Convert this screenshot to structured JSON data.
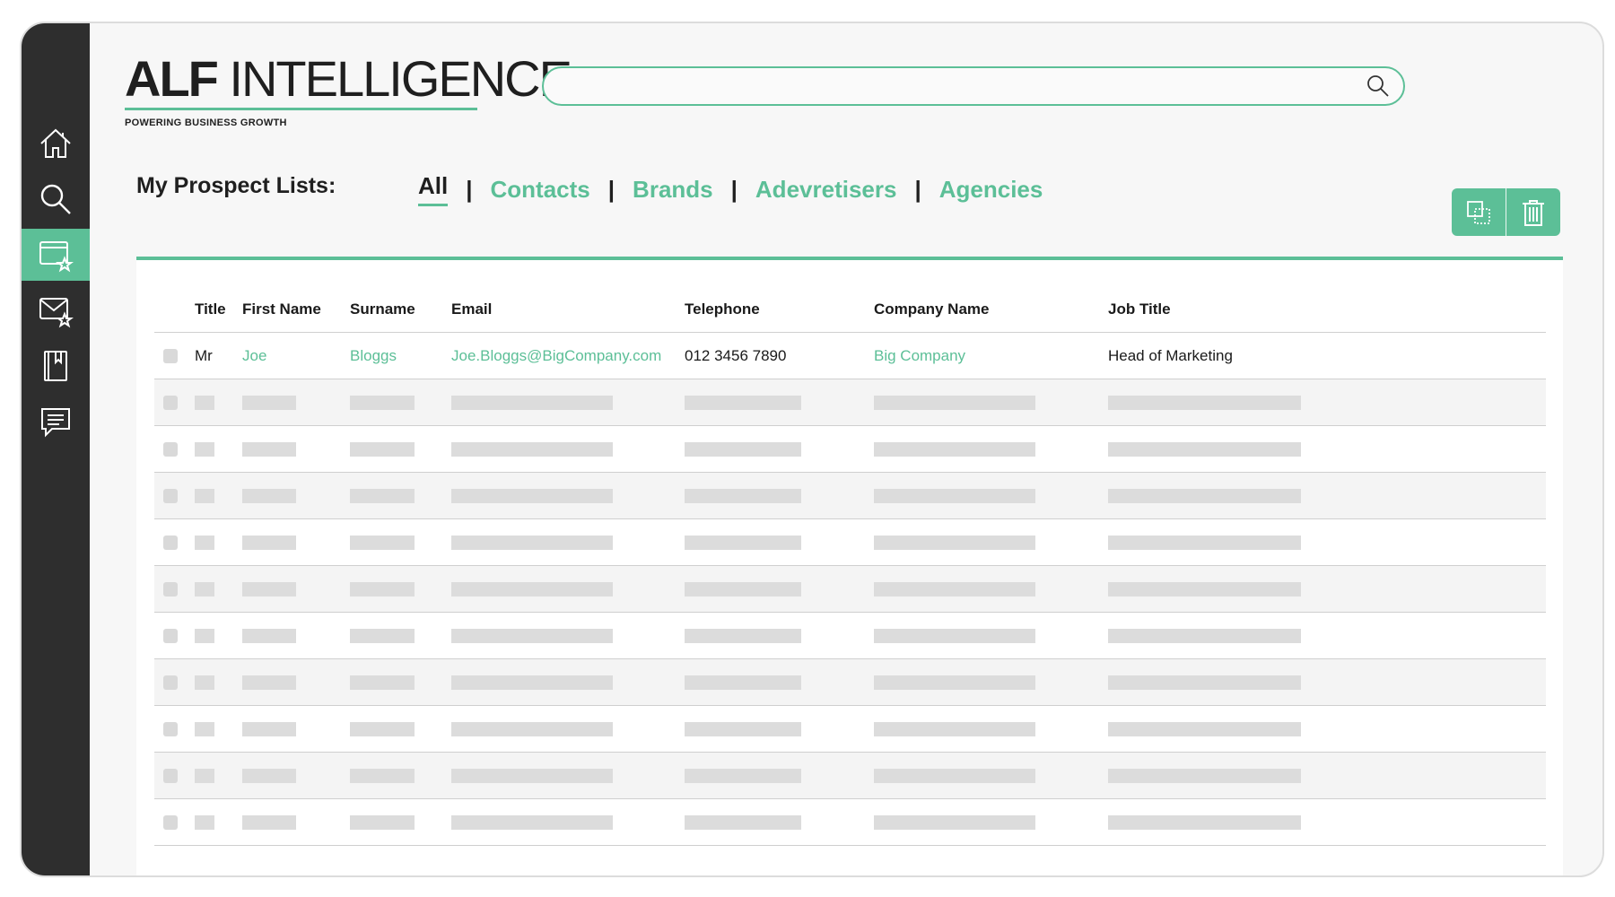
{
  "brand": {
    "logo_bold": "ALF",
    "logo_light": " INTELLIGENCE",
    "tagline": "POWERING BUSINESS GROWTH",
    "accent_color": "#5cbf97"
  },
  "sidebar": {
    "items": [
      {
        "icon": "home-icon",
        "active": false
      },
      {
        "icon": "search-icon",
        "active": false
      },
      {
        "icon": "browser-star-icon",
        "active": true
      },
      {
        "icon": "mail-star-icon",
        "active": false
      },
      {
        "icon": "bookmark-book-icon",
        "active": false
      },
      {
        "icon": "chat-icon",
        "active": false
      }
    ]
  },
  "search": {
    "placeholder": "",
    "value": ""
  },
  "prospect_lists": {
    "title": "My Prospect Lists:",
    "tabs": [
      {
        "label": "All",
        "active": true
      },
      {
        "label": "Contacts",
        "active": false
      },
      {
        "label": "Brands",
        "active": false
      },
      {
        "label": "Adevretisers",
        "active": false
      },
      {
        "label": "Agencies",
        "active": false
      }
    ],
    "separator": "|"
  },
  "actions": {
    "copy_icon": "copy-icon",
    "delete_icon": "trash-icon"
  },
  "table": {
    "columns": [
      "Title",
      "First Name",
      "Surname",
      "Email",
      "Telephone",
      "Company Name",
      "Job Title"
    ],
    "rows": [
      {
        "title": "Mr",
        "first_name": "Joe",
        "surname": "Bloggs",
        "email": "Joe.Bloggs@BigCompany.com",
        "telephone": "012 3456 7890",
        "company": "Big Company",
        "job_title": "Head of Marketing"
      }
    ],
    "placeholder_rows": 10
  }
}
